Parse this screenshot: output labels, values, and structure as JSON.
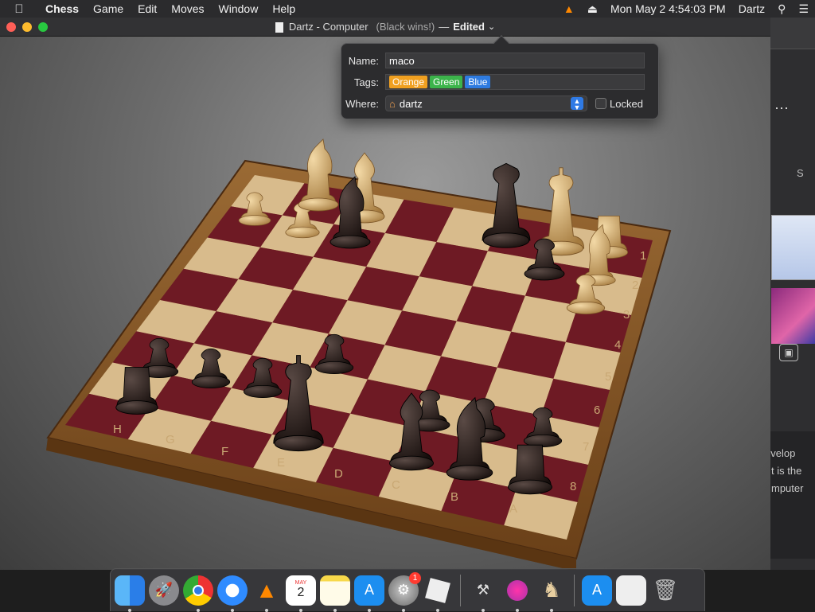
{
  "menubar": {
    "app_name": "Chess",
    "items": [
      "Game",
      "Edit",
      "Moves",
      "Window",
      "Help"
    ],
    "clock": "Mon May 2  4:54:03 PM",
    "user": "Dartz"
  },
  "window": {
    "title": "Dartz - Computer",
    "status": "(Black wins!)",
    "separator": "—",
    "edited_label": "Edited"
  },
  "popover": {
    "name_label": "Name:",
    "name_value": "maco",
    "tags_label": "Tags:",
    "tags": [
      {
        "label": "Orange",
        "color": "#f0a020"
      },
      {
        "label": "Green",
        "color": "#3cb44b"
      },
      {
        "label": "Blue",
        "color": "#2e7be0"
      }
    ],
    "where_label": "Where:",
    "where_value": "dartz",
    "locked_label": "Locked"
  },
  "board": {
    "files": [
      "H",
      "G",
      "F",
      "E",
      "D",
      "C",
      "B",
      "A"
    ],
    "ranks": [
      "1",
      "2",
      "3",
      "4",
      "5",
      "6",
      "7",
      "8"
    ]
  },
  "background_window": {
    "partial_letter": "S",
    "text_lines": [
      "evelop",
      "t is the",
      "mputer"
    ]
  },
  "dock": {
    "apps": [
      "finder",
      "launchpad",
      "chrome",
      "safari",
      "vlc",
      "calendar",
      "notes",
      "app-store",
      "system-preferences",
      "roblox",
      "instruments",
      "installer",
      "chess",
      "app-store-2",
      "preview",
      "trash"
    ],
    "calendar_month": "MAY",
    "calendar_day": "2",
    "system_prefs_badge": "1"
  },
  "colors": {
    "dark_square": "#6e1a24",
    "light_square": "#d8bb8c",
    "board_frame": "#8a5a2a",
    "accent": "#2f7ae5"
  }
}
